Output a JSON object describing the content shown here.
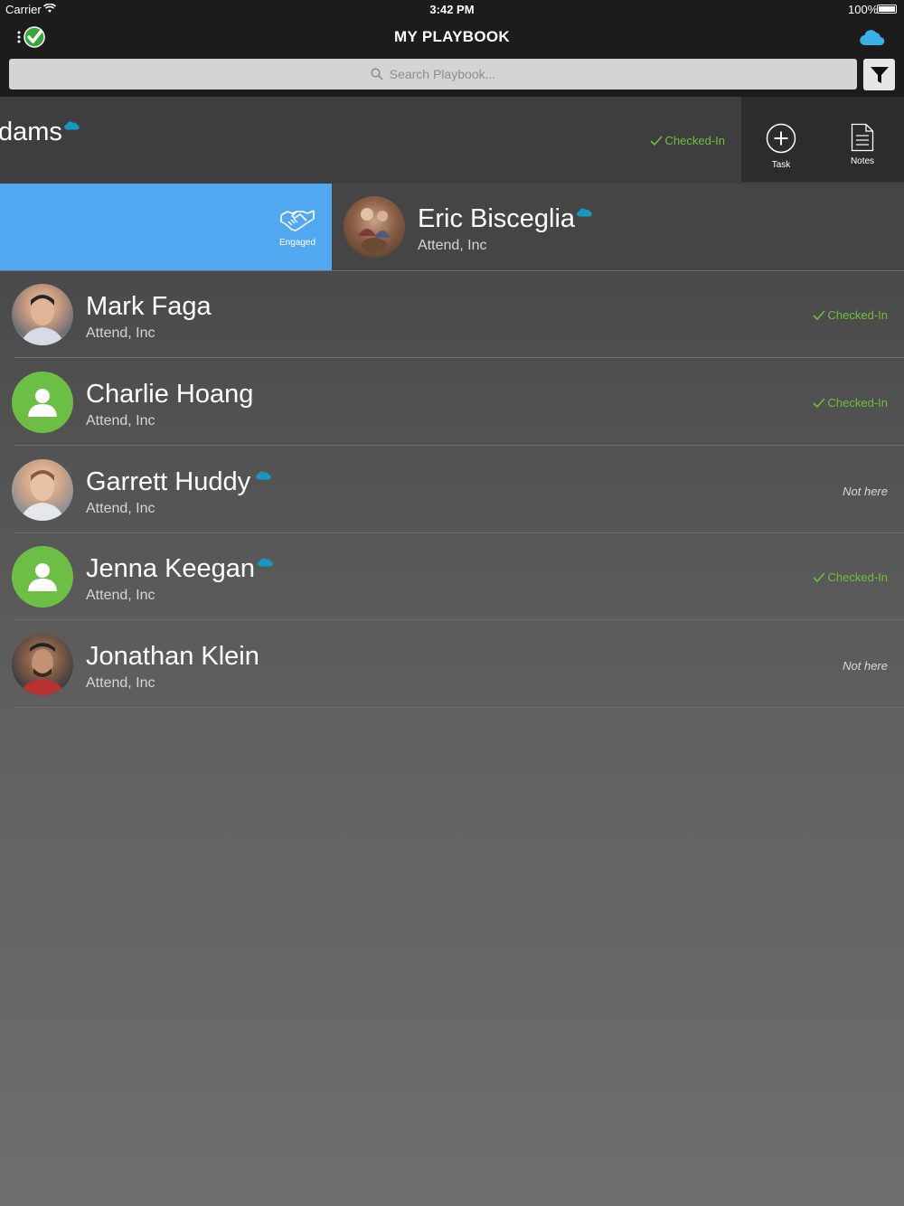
{
  "status_bar": {
    "carrier": "Carrier",
    "time": "3:42 PM",
    "battery": "100%"
  },
  "nav": {
    "title": "MY PLAYBOOK"
  },
  "search": {
    "placeholder": "Search Playbook..."
  },
  "swiped_row": {
    "name_fragment": "dams",
    "status": "Checked-In",
    "actions": [
      {
        "label": "Task",
        "icon": "plus-circle-icon"
      },
      {
        "label": "Notes",
        "icon": "notes-icon"
      }
    ]
  },
  "engaged_row": {
    "action_label": "Engaged",
    "name": "Eric Bisceglia",
    "company": "Attend, Inc"
  },
  "contacts": [
    {
      "name": "Mark Faga",
      "company": "Attend, Inc",
      "status": "Checked-In",
      "status_type": "checked",
      "salesforce": false,
      "avatar": "photo"
    },
    {
      "name": "Charlie Hoang",
      "company": "Attend, Inc",
      "status": "Checked-In",
      "status_type": "checked",
      "salesforce": false,
      "avatar": "default"
    },
    {
      "name": "Garrett Huddy",
      "company": "Attend, Inc",
      "status": "Not here",
      "status_type": "away",
      "salesforce": true,
      "avatar": "photo"
    },
    {
      "name": "Jenna Keegan",
      "company": "Attend, Inc",
      "status": "Checked-In",
      "status_type": "checked",
      "salesforce": true,
      "avatar": "default"
    },
    {
      "name": "Jonathan Klein",
      "company": "Attend, Inc",
      "status": "Not here",
      "status_type": "away",
      "salesforce": false,
      "avatar": "photo"
    }
  ],
  "colors": {
    "checked_in": "#6fbf3b",
    "engaged_blue": "#52a8f0",
    "avatar_green": "#6dbe45",
    "salesforce_blue": "#1798c1"
  }
}
